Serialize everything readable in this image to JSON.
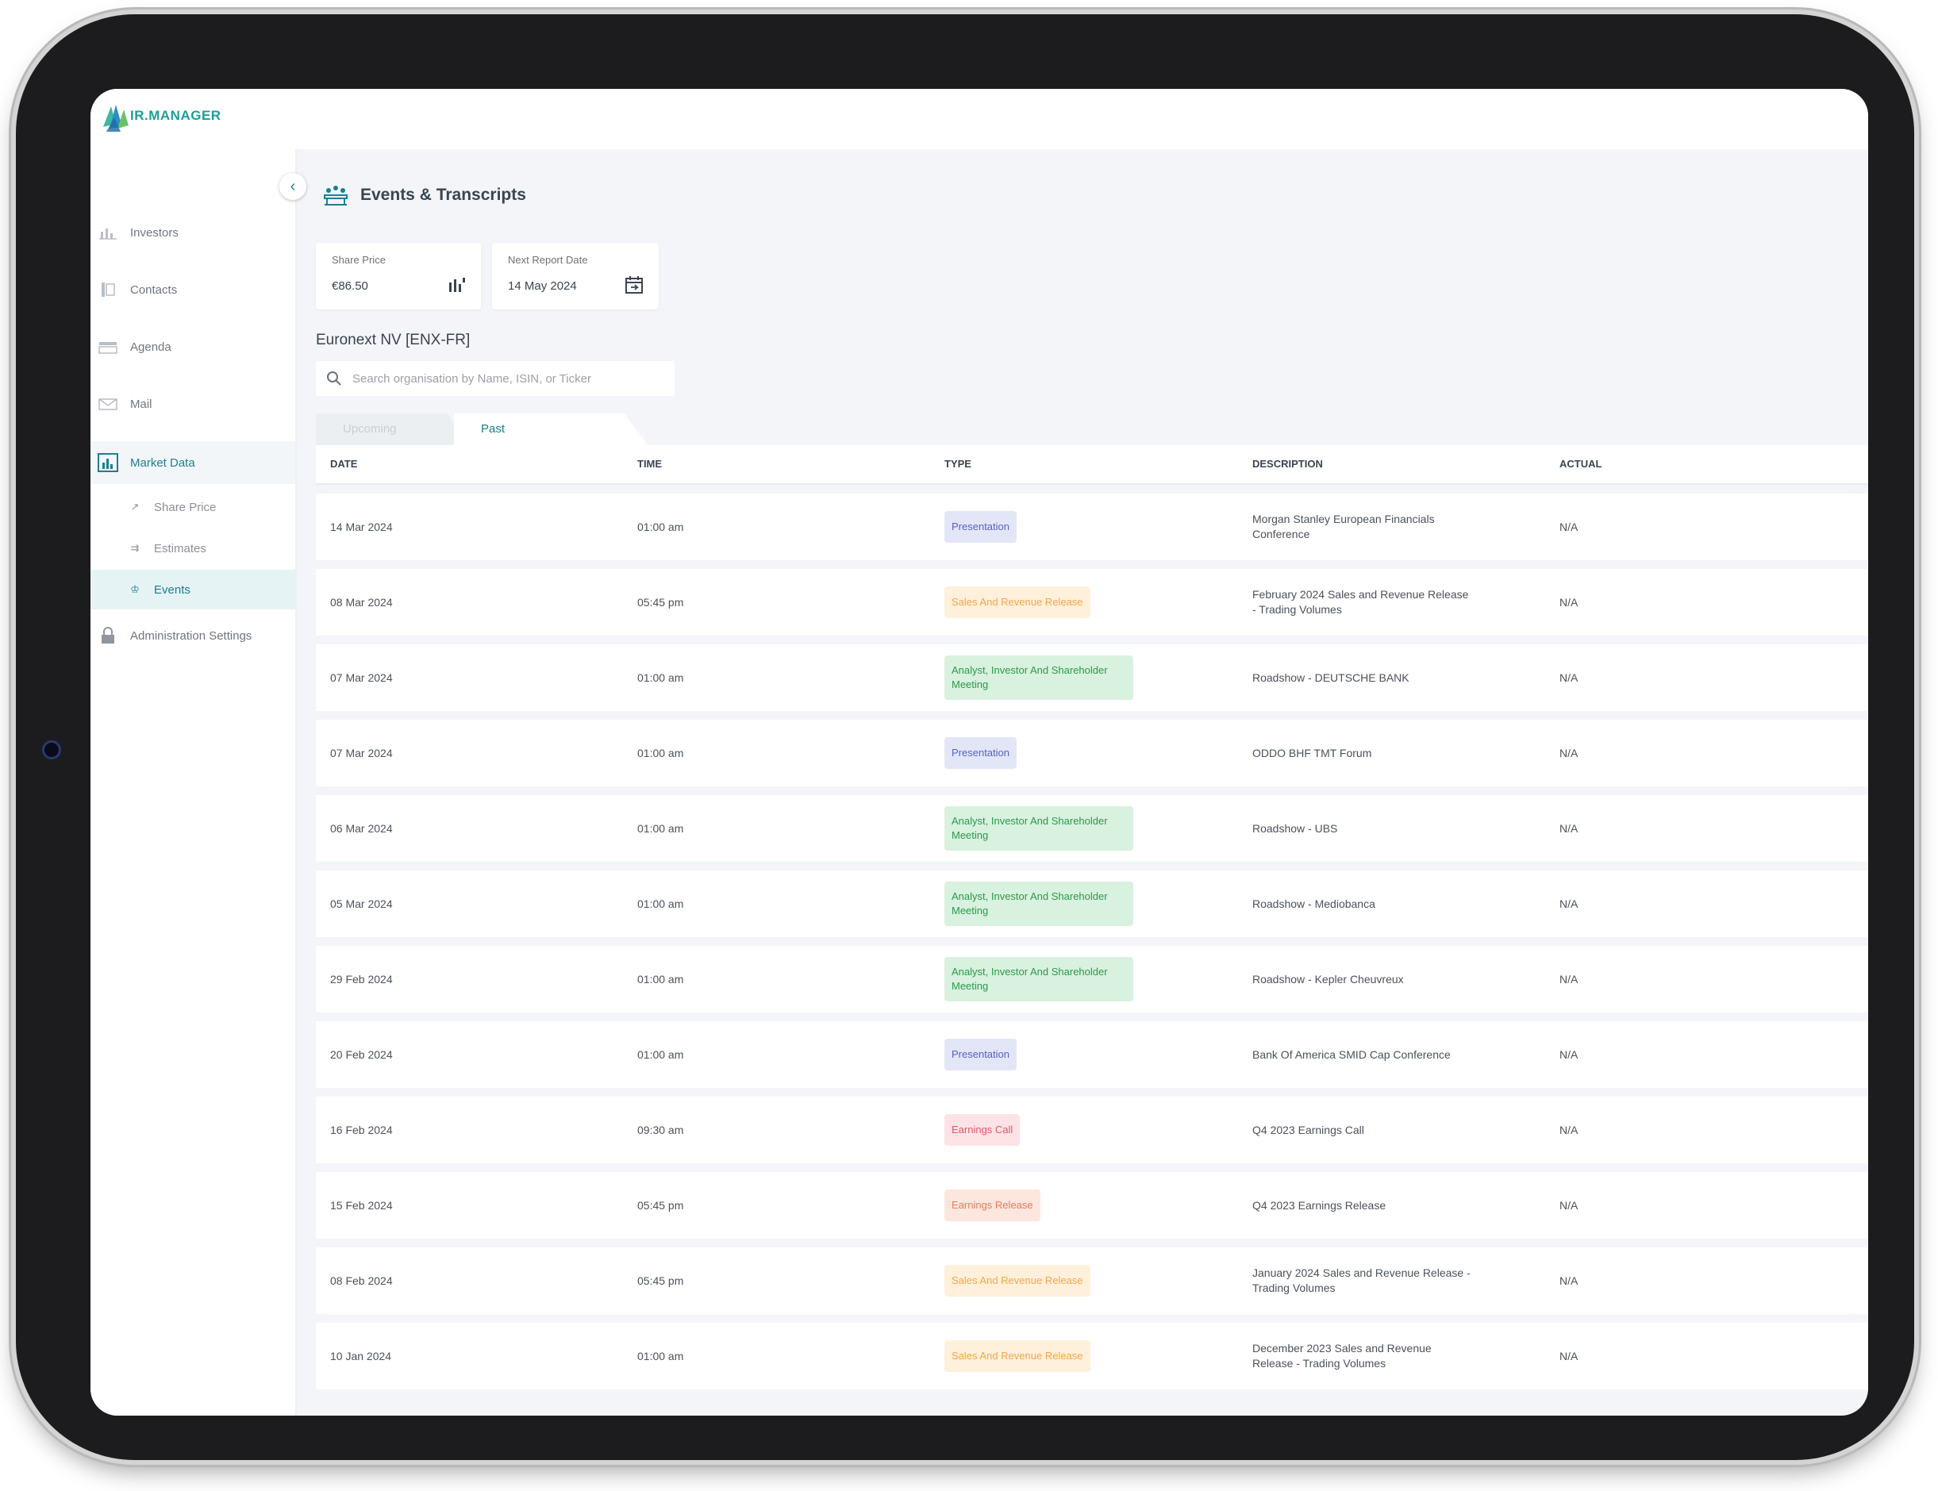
{
  "app": {
    "logo_text": "IR.MANAGER",
    "brand_color": "#1b9f95",
    "accent_color": "#1b7f92"
  },
  "sidebar": {
    "items": [
      {
        "label": "Investors",
        "icon": "investors-icon"
      },
      {
        "label": "Contacts",
        "icon": "contacts-icon"
      },
      {
        "label": "Agenda",
        "icon": "agenda-icon"
      },
      {
        "label": "Mail",
        "icon": "mail-icon"
      },
      {
        "label": "Market Data",
        "icon": "market-data-icon",
        "active": true
      },
      {
        "label": "Administration Settings",
        "icon": "lock-icon"
      }
    ],
    "sub_items": [
      {
        "label": "Share Price",
        "icon": "trend-icon"
      },
      {
        "label": "Estimates",
        "icon": "estimates-icon"
      },
      {
        "label": "Events",
        "icon": "events-icon",
        "active": true
      }
    ]
  },
  "page": {
    "title": "Events & Transcripts"
  },
  "cards": {
    "share_price": {
      "label": "Share Price",
      "value": "€86.50"
    },
    "next_report": {
      "label": "Next Report Date",
      "value": "14 May 2024"
    }
  },
  "org": {
    "name": "Euronext NV [ENX-FR]"
  },
  "search": {
    "placeholder": "Search organisation by Name, ISIN, or Ticker",
    "value": ""
  },
  "tabs": {
    "upcoming": "Upcoming",
    "past": "Past",
    "active": "Past"
  },
  "table": {
    "headers": {
      "date": "DATE",
      "time": "TIME",
      "type": "TYPE",
      "description": "DESCRIPTION",
      "actual": "ACTUAL"
    },
    "rows": [
      {
        "date": "14 Mar 2024",
        "time": "01:00 am",
        "type": "Presentation",
        "description": "Morgan Stanley European Financials Conference",
        "actual": "N/A"
      },
      {
        "date": "08 Mar 2024",
        "time": "05:45 pm",
        "type": "Sales And Revenue Release",
        "description": "February 2024 Sales and Revenue Release - Trading Volumes",
        "actual": "N/A"
      },
      {
        "date": "07 Mar 2024",
        "time": "01:00 am",
        "type": "Analyst, Investor And Shareholder Meeting",
        "description": "Roadshow - DEUTSCHE BANK",
        "actual": "N/A"
      },
      {
        "date": "07 Mar 2024",
        "time": "01:00 am",
        "type": "Presentation",
        "description": "ODDO BHF TMT Forum",
        "actual": "N/A"
      },
      {
        "date": "06 Mar 2024",
        "time": "01:00 am",
        "type": "Analyst, Investor And Shareholder Meeting",
        "description": "Roadshow - UBS",
        "actual": "N/A"
      },
      {
        "date": "05 Mar 2024",
        "time": "01:00 am",
        "type": "Analyst, Investor And Shareholder Meeting",
        "description": "Roadshow - Mediobanca",
        "actual": "N/A"
      },
      {
        "date": "29 Feb 2024",
        "time": "01:00 am",
        "type": "Analyst, Investor And Shareholder Meeting",
        "description": "Roadshow - Kepler Cheuvreux",
        "actual": "N/A"
      },
      {
        "date": "20 Feb 2024",
        "time": "01:00 am",
        "type": "Presentation",
        "description": "Bank Of America SMID Cap Conference",
        "actual": "N/A"
      },
      {
        "date": "16 Feb 2024",
        "time": "09:30 am",
        "type": "Earnings Call",
        "description": "Q4 2023 Earnings Call",
        "actual": "N/A"
      },
      {
        "date": "15 Feb 2024",
        "time": "05:45 pm",
        "type": "Earnings Release",
        "description": "Q4 2023 Earnings Release",
        "actual": "N/A"
      },
      {
        "date": "08 Feb 2024",
        "time": "05:45 pm",
        "type": "Sales And Revenue Release",
        "description": "January 2024 Sales and Revenue Release - Trading Volumes",
        "actual": "N/A"
      },
      {
        "date": "10 Jan 2024",
        "time": "01:00 am",
        "type": "Sales And Revenue Release",
        "description": "December 2023 Sales and Revenue Release - Trading Volumes",
        "actual": "N/A"
      }
    ]
  }
}
